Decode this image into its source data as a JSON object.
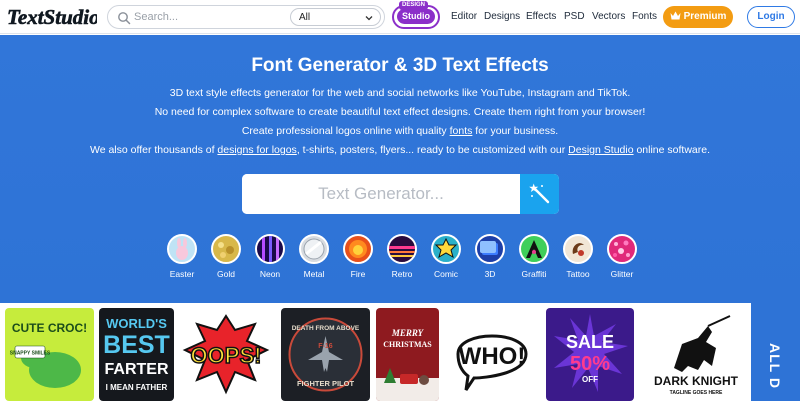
{
  "header": {
    "logo_text": "TextStudio",
    "search_placeholder": "Search...",
    "category_value": "All",
    "studio_badge": "DESIGN",
    "studio_label": "Studio",
    "nav": [
      "Editor",
      "Designs",
      "Effects",
      "PSD",
      "Vectors",
      "Fonts"
    ],
    "premium_label": "Premium",
    "login_label": "Login"
  },
  "hero": {
    "title": "Font Generator & 3D Text Effects",
    "line1": "3D text style effects generator for the web and social networks like YouTube, Instagram and TikTok.",
    "line2": "No need for complex software to create beautiful text effect designs. Create them right from your browser!",
    "line3_pre": "Create professional logos online with quality ",
    "line3_link": "fonts",
    "line3_post": " for your business.",
    "line4_pre": "We also offer thousands of ",
    "line4_link1": "designs for logos",
    "line4_mid": ", t-shirts, posters, flyers... ready to be customized with our ",
    "line4_link2": "Design Studio",
    "line4_post": " online software.",
    "generator_placeholder": "Text Generator..."
  },
  "styles": [
    "Easter",
    "Gold",
    "Neon",
    "Metal",
    "Fire",
    "Retro",
    "Comic",
    "3D",
    "Graffiti",
    "Tattoo",
    "Glitter"
  ],
  "cards": {
    "croc_title": "CUTE CROC!",
    "croc_sub": "SNAPPY SMILES",
    "farter_l1": "WORLD'S",
    "farter_l2": "BEST",
    "farter_l3": "FARTER",
    "farter_l4": "I MEAN FATHER",
    "oops": "OOPS!",
    "pilot_top": "DEATH FROM ABOVE",
    "pilot_mid": "F-16",
    "pilot_bottom": "FIGHTER PILOT",
    "xmas_l1": "MERRY",
    "xmas_l2": "CHRISTMAS",
    "who": "WHO!",
    "sale_l1": "SALE",
    "sale_l2": "50%",
    "sale_l3": "OFF",
    "knight_l1": "DARK KNIGHT",
    "knight_l2": "TAGLINE GOES HERE"
  },
  "side_tab_label": "ALL D",
  "colors": {
    "hero_bg": "#2e73d6",
    "accent_purple": "#8b2fc9",
    "premium_orange": "#f39c12",
    "login_blue": "#2f7ae5",
    "generator_button": "#1aa3ee"
  }
}
